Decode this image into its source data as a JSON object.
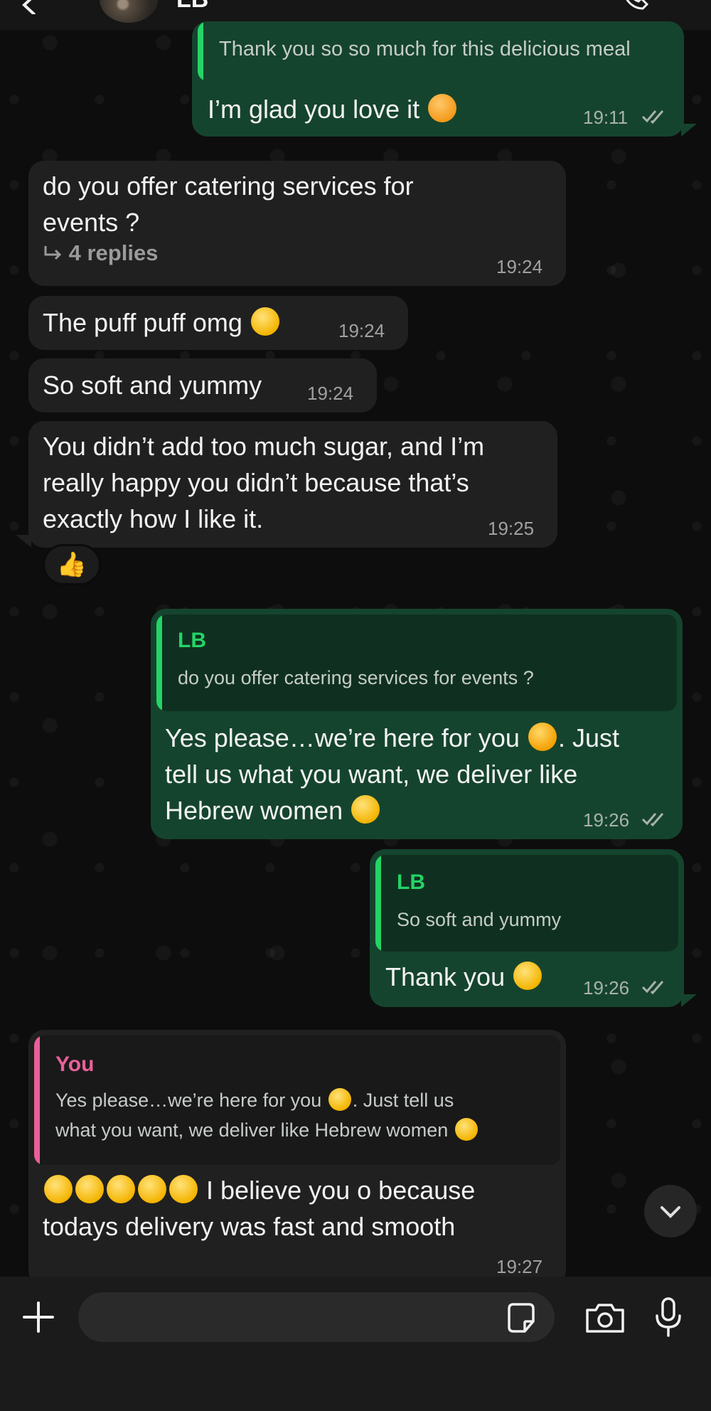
{
  "header": {
    "contact_name": "LB"
  },
  "messages": [
    {
      "id": "m1",
      "direction": "outgoing",
      "quote_text": "Thank you so so much for this delicious meal",
      "text": "I’m glad you love it",
      "emoji": "smiling-face-with-hearts",
      "time": "19:11",
      "status": "read"
    },
    {
      "id": "m2",
      "direction": "incoming",
      "lines": [
        "do you offer catering services for",
        "events ?"
      ],
      "thread_label": "4 replies",
      "time": "19:24"
    },
    {
      "id": "m3",
      "direction": "incoming",
      "text": "The puff puff omg",
      "emoji": "face-savoring-food",
      "time": "19:24"
    },
    {
      "id": "m4",
      "direction": "incoming",
      "text": "So soft and yummy",
      "time": "19:24"
    },
    {
      "id": "m5",
      "direction": "incoming",
      "lines": [
        "You didn’t add too much sugar, and I’m",
        "really happy you didn’t because that’s",
        "exactly how I like it."
      ],
      "time": "19:25",
      "reaction": "👍"
    },
    {
      "id": "m6",
      "direction": "outgoing",
      "quote_name": "LB",
      "quote_text": "do you offer catering services for events ?",
      "lines": [
        "Yes please…we’re here for you",
        ". Just",
        "tell us what you want, we deliver like",
        "Hebrew women"
      ],
      "time": "19:26",
      "status": "read"
    },
    {
      "id": "m7",
      "direction": "outgoing",
      "quote_name": "LB",
      "quote_text": "So soft and yummy",
      "text": "Thank you",
      "emoji": "star-struck",
      "time": "19:26",
      "status": "read"
    },
    {
      "id": "m8",
      "direction": "incoming",
      "quote_name": "You",
      "quote_lines": [
        "Yes please…we’re here for you",
        ". Just tell us",
        "what you want, we deliver like Hebrew women"
      ],
      "lines": [
        "I believe you o because",
        "todays delivery was fast and smooth"
      ],
      "emoji_count": 5,
      "time": "19:27"
    }
  ],
  "colors": {
    "outgoing_bubble": "#15442e",
    "incoming_bubble": "#202020",
    "quote_green": "#25d366",
    "quote_pink": "#e8609a"
  },
  "input": {
    "placeholder": "",
    "value": ""
  },
  "icons": [
    "back-icon",
    "call-icon",
    "double-check-icon",
    "reply-arrow-icon",
    "chevron-down-icon",
    "plus-icon",
    "sticker-icon",
    "camera-icon",
    "microphone-icon"
  ]
}
